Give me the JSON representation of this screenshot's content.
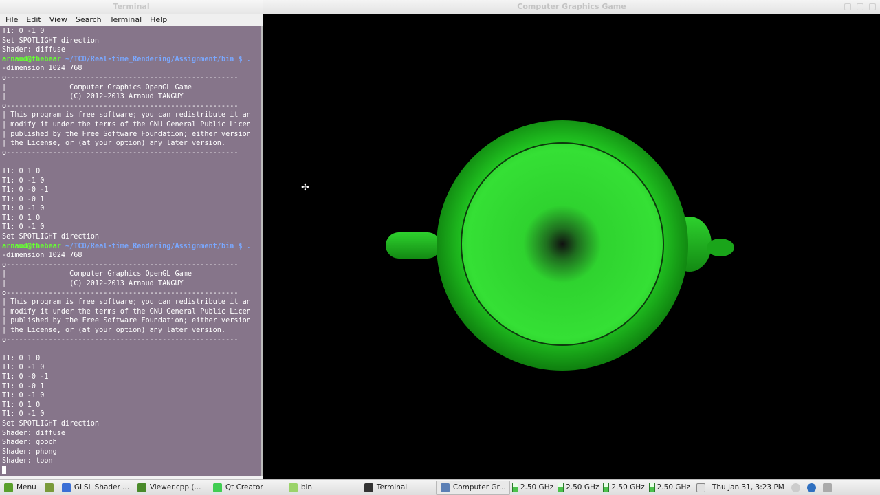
{
  "terminal": {
    "title": "Terminal",
    "menu": [
      "File",
      "Edit",
      "View",
      "Search",
      "Terminal",
      "Help"
    ],
    "lines": [
      {
        "t": "T1: 0 -1 0"
      },
      {
        "t": "Set SPOTLIGHT direction"
      },
      {
        "t": "Shader: diffuse"
      },
      {
        "user": "arnaud@thebear",
        "path": " ~/TCD/Real-time_Rendering/Assignment/bin $ ."
      },
      {
        "t": "-dimension 1024 768"
      },
      {
        "t": "o-------------------------------------------------------"
      },
      {
        "t": "|               Computer Graphics OpenGL Game"
      },
      {
        "t": "|               (C) 2012-2013 Arnaud TANGUY"
      },
      {
        "t": "o-------------------------------------------------------"
      },
      {
        "t": "| This program is free software; you can redistribute it an"
      },
      {
        "t": "| modify it under the terms of the GNU General Public Licen"
      },
      {
        "t": "| published by the Free Software Foundation; either version"
      },
      {
        "t": "| the License, or (at your option) any later version."
      },
      {
        "t": "o-------------------------------------------------------"
      },
      {
        "t": ""
      },
      {
        "t": "T1: 0 1 0"
      },
      {
        "t": "T1: 0 -1 0"
      },
      {
        "t": "T1: 0 -0 -1"
      },
      {
        "t": "T1: 0 -0 1"
      },
      {
        "t": "T1: 0 -1 0"
      },
      {
        "t": "T1: 0 1 0"
      },
      {
        "t": "T1: 0 -1 0"
      },
      {
        "t": "Set SPOTLIGHT direction"
      },
      {
        "user": "arnaud@thebear",
        "path": " ~/TCD/Real-time_Rendering/Assignment/bin $ ."
      },
      {
        "t": "-dimension 1024 768"
      },
      {
        "t": "o-------------------------------------------------------"
      },
      {
        "t": "|               Computer Graphics OpenGL Game"
      },
      {
        "t": "|               (C) 2012-2013 Arnaud TANGUY"
      },
      {
        "t": "o-------------------------------------------------------"
      },
      {
        "t": "| This program is free software; you can redistribute it an"
      },
      {
        "t": "| modify it under the terms of the GNU General Public Licen"
      },
      {
        "t": "| published by the Free Software Foundation; either version"
      },
      {
        "t": "| the License, or (at your option) any later version."
      },
      {
        "t": "o-------------------------------------------------------"
      },
      {
        "t": ""
      },
      {
        "t": "T1: 0 1 0"
      },
      {
        "t": "T1: 0 -1 0"
      },
      {
        "t": "T1: 0 -0 -1"
      },
      {
        "t": "T1: 0 -0 1"
      },
      {
        "t": "T1: 0 -1 0"
      },
      {
        "t": "T1: 0 1 0"
      },
      {
        "t": "T1: 0 -1 0"
      },
      {
        "t": "Set SPOTLIGHT direction"
      },
      {
        "t": "Shader: diffuse"
      },
      {
        "t": "Shader: gooch"
      },
      {
        "t": "Shader: phong"
      },
      {
        "t": "Shader: toon"
      }
    ]
  },
  "game": {
    "title": "Computer Graphics Game",
    "object_color": "#1fbf1f",
    "background": "#000000"
  },
  "taskbar": {
    "menu_label": "Menu",
    "tasks": [
      {
        "label": "GLSL Shader ...",
        "icon": "browser-icon",
        "color": "#3b6fd6"
      },
      {
        "label": "Viewer.cpp (...",
        "icon": "editor-icon",
        "color": "#4a8a2a"
      },
      {
        "label": "Qt Creator",
        "icon": "qt-icon",
        "color": "#41cd52"
      },
      {
        "label": "bin",
        "icon": "folder-icon",
        "color": "#9bd36a"
      },
      {
        "label": "Terminal",
        "icon": "terminal-icon",
        "color": "#333333"
      },
      {
        "label": "Computer Gr...",
        "icon": "window-icon",
        "color": "#5b7fb5",
        "active": true
      }
    ],
    "cpu": [
      "2.50 GHz",
      "2.50 GHz",
      "2.50 GHz",
      "2.50 GHz"
    ],
    "clock": "Thu Jan 31,  3:23 PM"
  }
}
